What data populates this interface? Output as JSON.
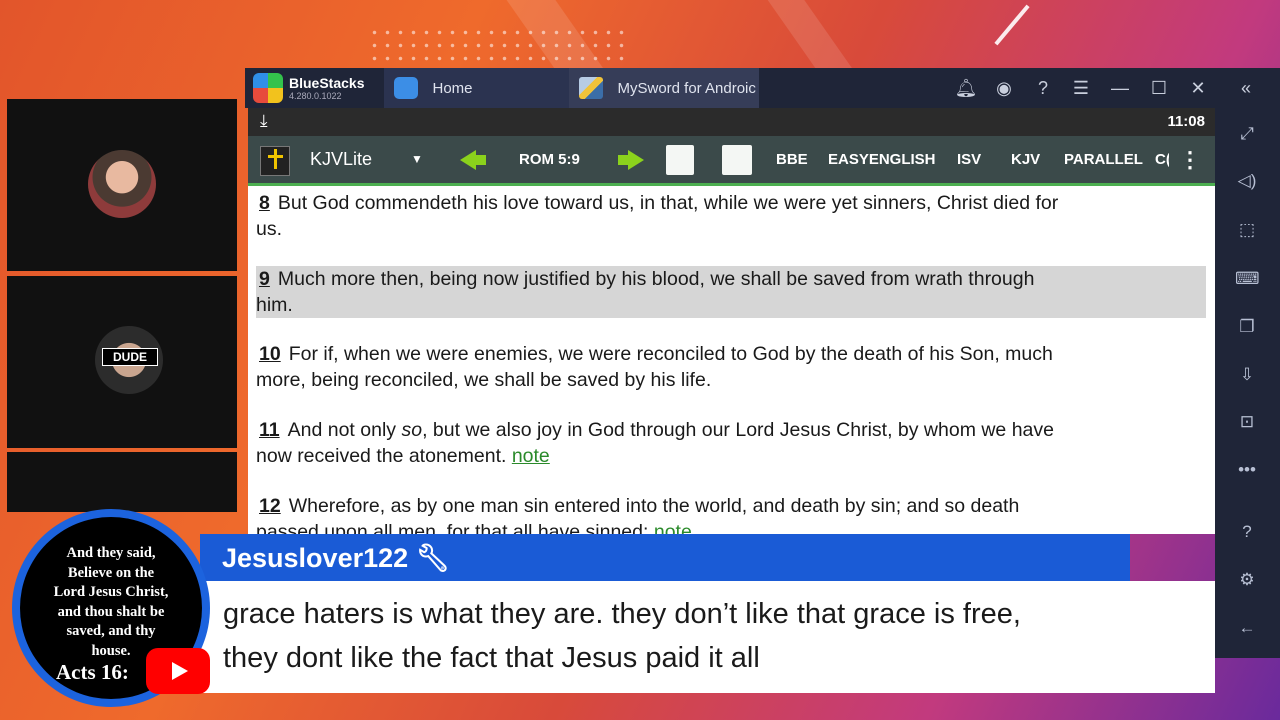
{
  "window": {
    "brand": "BlueStacks",
    "version": "4.280.0.1022",
    "tabs": [
      {
        "label": "Home",
        "icon": "home-icon"
      },
      {
        "label": "MySword for Androic",
        "icon": "mysword-icon"
      }
    ],
    "controls": [
      "bell-icon",
      "account-icon",
      "help-icon",
      "menu-icon",
      "minimize-icon",
      "maximize-icon",
      "close-icon",
      "collapse-icon"
    ]
  },
  "status": {
    "time": "11:08",
    "icon": "download-icon"
  },
  "toolbar": {
    "bible": "KJVLite",
    "reference": "ROM 5:9",
    "versions": [
      "BBE",
      "EASYENGLISH",
      "ISV",
      "KJV",
      "PARALLEL",
      "C("
    ]
  },
  "verses": [
    {
      "num": "8",
      "text": "But God commendeth his love toward us, in that, while we were yet sinners, Christ died for",
      "text2": "us.",
      "highlight": false
    },
    {
      "num": "9",
      "text": "Much more then, being now justified by his blood, we shall be saved from wrath through",
      "text2": "him.",
      "highlight": true
    },
    {
      "num": "10",
      "text": "For if, when we were enemies, we were reconciled to God by the death of his Son, much",
      "text2": "more, being reconciled, we shall be saved by his life.",
      "highlight": false
    },
    {
      "num": "11",
      "pre": "And not only ",
      "italic": "so",
      "post": ", but we also joy in God through our Lord Jesus Christ, by whom we have",
      "text2": "now received the atonement. ",
      "note": "note",
      "highlight": false
    },
    {
      "num": "12",
      "text": "Wherefore, as by one man sin entered into the world, and death by sin; and so death",
      "text2": "passed upon all men, for that all have sinned: ",
      "note": "note",
      "highlight": false
    }
  ],
  "sidebar_icons": [
    "fullscreen-icon",
    "volume-icon",
    "cursor-icon",
    "keyboard-icon",
    "copy-icon",
    "apk-icon",
    "screenshot-icon",
    "more-icon",
    "help-icon",
    "settings-icon",
    "back-icon"
  ],
  "chat": {
    "user": "Jesuslover122",
    "line1": "grace haters is what they are. they don’t like that grace is free,",
    "line2": "they dont like the fact that Jesus paid it all"
  },
  "badge": {
    "verse_lines": [
      "And they said,",
      "Believe on the",
      "Lord Jesus Christ,",
      "and thou shalt be",
      "saved, and thy",
      "house."
    ],
    "reference": "Acts 16:"
  },
  "cam_overlay": "DUDE",
  "colors": {
    "accent_green": "#4caf50",
    "chat_blue": "#1a5bd6",
    "link_green": "#2a8a2a"
  }
}
